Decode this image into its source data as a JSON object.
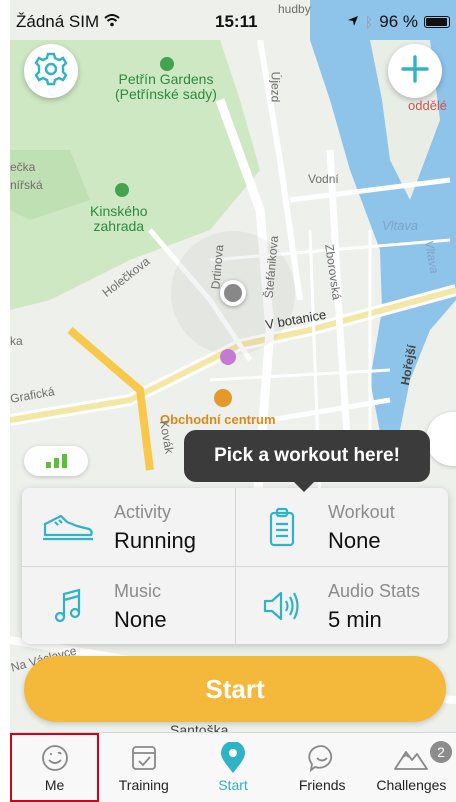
{
  "status_bar": {
    "carrier": "Žádná SIM",
    "time": "15:11",
    "battery": "96 %"
  },
  "map": {
    "labels": {
      "petrin": "Petřín Gardens\n(Petřínské sady)",
      "kinskeho": "Kinského\nzahrada",
      "vodni": "Vodní",
      "vltava1": "Vltava",
      "vltava2": "Vltava",
      "ujezd": "Újezd",
      "holeckova": "Holečkova",
      "v_botanice": "V botanice",
      "drtinova": "Drtinova",
      "stefanikova": "Štefánikova",
      "zborovska": "Zborovská",
      "graficka": "Grafická",
      "obchodni": "Obchodní centrum",
      "kovak": "Kovák",
      "na_vaclavce": "Na Václavce",
      "santoska": "Santoška",
      "oddele": "oddělé",
      "hudby": "hudby",
      "ecka": "ečka",
      "nirska": "nířská",
      "hore": "Hořejší",
      "ka": "ka"
    }
  },
  "buttons": {
    "settings": "settings-gear",
    "add": "+"
  },
  "tooltip": "Pick a workout here!",
  "panel": {
    "activity": {
      "label": "Activity",
      "value": "Running"
    },
    "workout": {
      "label": "Workout",
      "value": "None"
    },
    "music": {
      "label": "Music",
      "value": "None"
    },
    "audio": {
      "label": "Audio Stats",
      "value": "5 min"
    }
  },
  "start_label": "Start",
  "tabs": [
    {
      "label": "Me",
      "icon": "smiley-icon"
    },
    {
      "label": "Training",
      "icon": "calendar-check-icon"
    },
    {
      "label": "Start",
      "icon": "location-pin-icon"
    },
    {
      "label": "Friends",
      "icon": "chat-smile-icon"
    },
    {
      "label": "Challenges",
      "icon": "mountain-icon",
      "badge": "2"
    }
  ],
  "colors": {
    "accent": "#2fb3c6",
    "start": "#f4b93b",
    "tooltip_bg": "#3b3b3b",
    "highlight": "#d0021b"
  }
}
